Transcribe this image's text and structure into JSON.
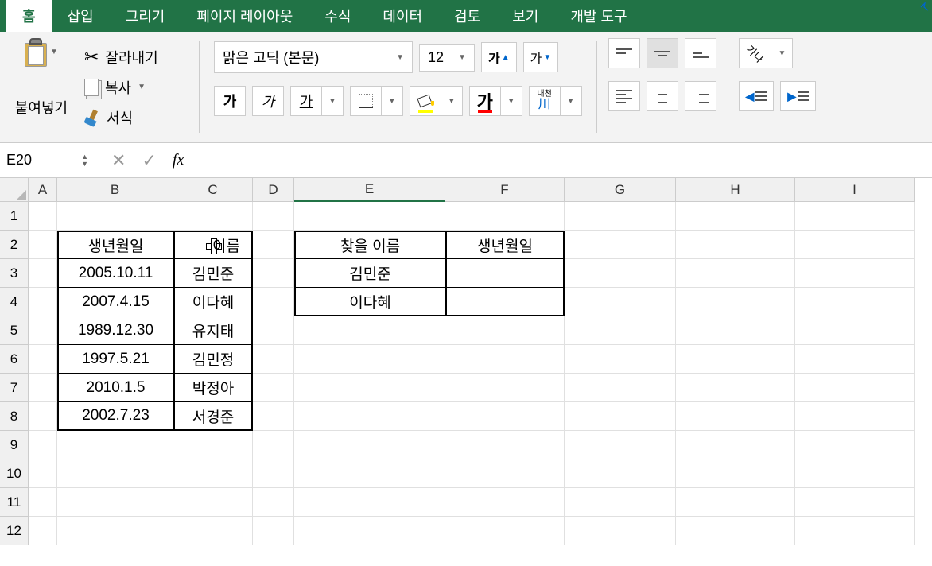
{
  "menu": {
    "tabs": [
      "홈",
      "삽입",
      "그리기",
      "페이지 레이아웃",
      "수식",
      "데이터",
      "검토",
      "보기",
      "개발 도구"
    ],
    "active": 0
  },
  "ribbon": {
    "paste": "붙여넣기",
    "cut": "잘라내기",
    "copy": "복사",
    "format": "서식",
    "font_name": "맑은 고딕 (본문)",
    "font_size": "12",
    "char_ga": "가",
    "char_kana": "가나",
    "ruby_top": "내천",
    "ruby_bottom": "川"
  },
  "formula": {
    "name_box": "E20",
    "fx": "fx"
  },
  "columns": [
    "A",
    "B",
    "C",
    "D",
    "E",
    "F",
    "G",
    "H",
    "I"
  ],
  "rows": [
    "1",
    "2",
    "3",
    "4",
    "5",
    "6",
    "7",
    "8",
    "9",
    "10",
    "11",
    "12"
  ],
  "table1": {
    "header_b": "생년월일",
    "header_c": "이름",
    "rows": [
      {
        "b": "2005.10.11",
        "c": "김민준"
      },
      {
        "b": "2007.4.15",
        "c": "이다혜"
      },
      {
        "b": "1989.12.30",
        "c": "유지태"
      },
      {
        "b": "1997.5.21",
        "c": "김민정"
      },
      {
        "b": "2010.1.5",
        "c": "박정아"
      },
      {
        "b": "2002.7.23",
        "c": "서경준"
      }
    ]
  },
  "table2": {
    "header_e": "찾을 이름",
    "header_f": "생년월일",
    "rows": [
      {
        "e": "김민준",
        "f": ""
      },
      {
        "e": "이다혜",
        "f": ""
      }
    ]
  }
}
